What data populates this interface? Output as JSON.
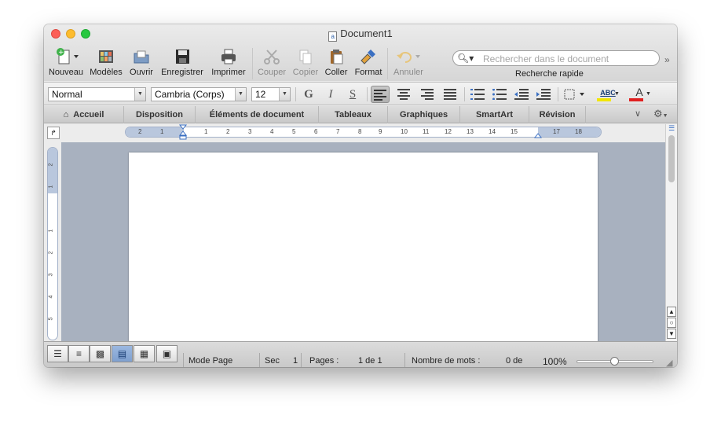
{
  "window": {
    "title": "Document1"
  },
  "toolbar": {
    "new_label": "Nouveau",
    "templates_label": "Modèles",
    "open_label": "Ouvrir",
    "save_label": "Enregistrer",
    "print_label": "Imprimer",
    "cut_label": "Couper",
    "copy_label": "Copier",
    "paste_label": "Coller",
    "format_label": "Format",
    "undo_label": "Annuler"
  },
  "search": {
    "placeholder": "Rechercher dans le document",
    "label": "Recherche rapide"
  },
  "format_bar": {
    "style_value": "Normal",
    "font_value": "Cambria (Corps)",
    "size_value": "12",
    "bold": "G",
    "italic": "I",
    "underline": "S",
    "highlight_sample": "ABC",
    "font_color_sample": "A"
  },
  "ribbon": {
    "tabs": [
      "Accueil",
      "Disposition",
      "Éléments de document",
      "Tableaux",
      "Graphiques",
      "SmartArt",
      "Révision"
    ]
  },
  "ruler": {
    "h_ticks": [
      "2",
      "1",
      "1",
      "2",
      "3",
      "4",
      "5",
      "6",
      "7",
      "8",
      "9",
      "10",
      "11",
      "12",
      "13",
      "14",
      "15",
      "17",
      "18"
    ],
    "v_ticks": [
      "2",
      "1",
      "1",
      "2",
      "3",
      "4",
      "5"
    ]
  },
  "status": {
    "view_mode": "Mode Page",
    "section_label": "Sec",
    "section_value": "1",
    "pages_label": "Pages :",
    "pages_value": "1 de 1",
    "words_label": "Nombre de mots :",
    "words_value": "0 de",
    "zoom": "100%"
  },
  "colors": {
    "accent_blue": "#7fa0cf",
    "highlight_yellow": "#f2e600",
    "font_red": "#e02020"
  },
  "icons": [
    "new-doc-icon",
    "templates-icon",
    "open-icon",
    "save-icon",
    "print-icon",
    "cut-icon",
    "copy-icon",
    "paste-icon",
    "format-painter-icon",
    "undo-icon",
    "search-icon",
    "home-icon",
    "gear-icon"
  ]
}
